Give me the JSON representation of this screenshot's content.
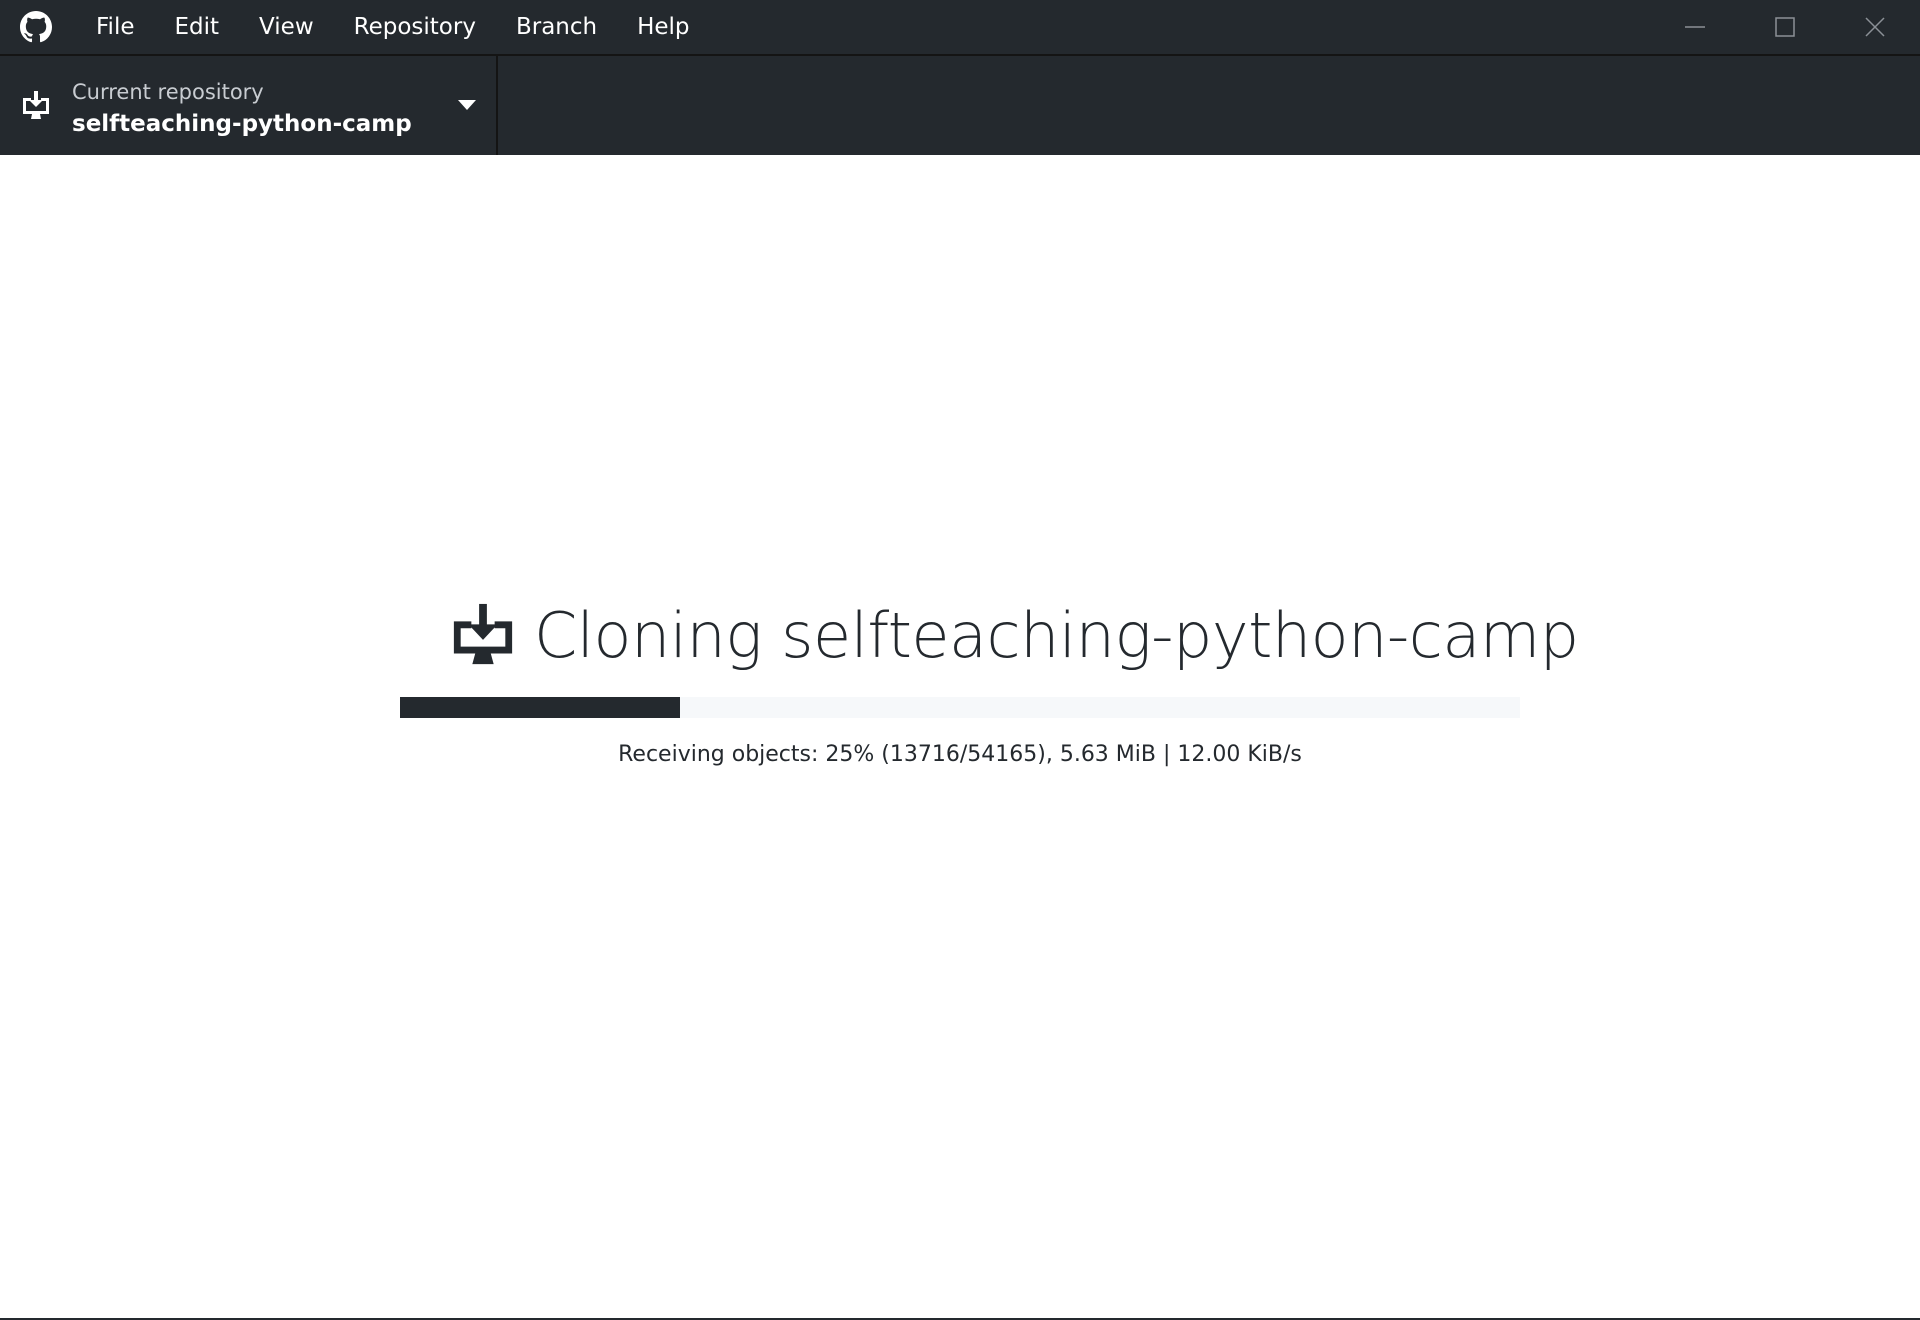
{
  "app": {
    "logo_icon": "github-octocat-icon"
  },
  "menu": {
    "items": [
      "File",
      "Edit",
      "View",
      "Repository",
      "Branch",
      "Help"
    ]
  },
  "window_controls": {
    "minimize_icon": "minimize-icon",
    "maximize_icon": "maximize-icon",
    "close_icon": "close-icon"
  },
  "toolbar": {
    "repo_selector": {
      "icon": "desktop-download-icon",
      "label": "Current repository",
      "name": "selfteaching-python-camp",
      "caret_icon": "triangle-down-icon"
    }
  },
  "clone": {
    "icon": "desktop-download-icon",
    "title": "Cloning selfteaching-python-camp",
    "progress_fraction": 0.25,
    "description": "Receiving objects: 25% (13716/54165), 5.63 MiB | 12.00 KiB/s"
  },
  "colors": {
    "chrome": "#24292e",
    "divider": "#141414",
    "progress_track": "#f6f8fa"
  }
}
